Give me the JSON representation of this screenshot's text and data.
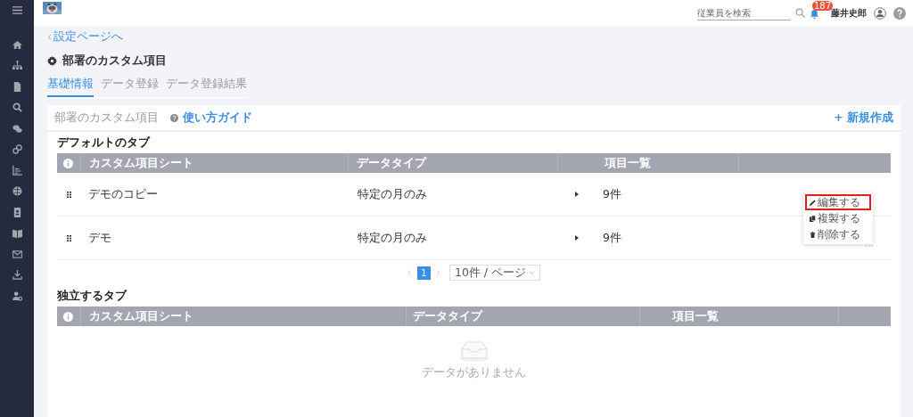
{
  "header": {
    "search": {
      "placeholder": "従業員を検索"
    },
    "notification_count": "187",
    "user_name": "藤井史郎"
  },
  "back_link": "設定ページへ",
  "page_title": "部署のカスタム項目",
  "tabs": [
    {
      "label": "基礎情報",
      "selected": true
    },
    {
      "label": "データ登録",
      "selected": false
    },
    {
      "label": "データ登録結果",
      "selected": false
    }
  ],
  "card": {
    "title": "部署のカスタム項目",
    "guide_link": "使い方ガイド",
    "new_button": "+ 新規作成"
  },
  "default_tabs": {
    "title": "デフォルトのタブ",
    "columns": [
      "カスタム項目シート",
      "データタイプ",
      "項目一覧"
    ],
    "rows": [
      {
        "name": "デモのコピー",
        "data_type": "特定の月のみ",
        "item_count": "9件"
      },
      {
        "name": "デモ",
        "data_type": "特定の月のみ",
        "item_count": "9件"
      }
    ]
  },
  "pagination": {
    "pages": [
      {
        "label": "1",
        "selected": true
      }
    ],
    "page_size": "10件 / ページ"
  },
  "action_menu": {
    "items": [
      {
        "label": "編集する",
        "kind": "edit",
        "highlighted": true
      },
      {
        "label": "複製する",
        "kind": "copy",
        "highlighted": false
      },
      {
        "label": "削除する",
        "kind": "delete",
        "highlighted": false
      }
    ]
  },
  "independent_tabs": {
    "title": "独立するタブ",
    "columns": [
      "カスタム項目シート",
      "データタイプ",
      "項目一覧"
    ],
    "empty_text": "データがありません"
  }
}
